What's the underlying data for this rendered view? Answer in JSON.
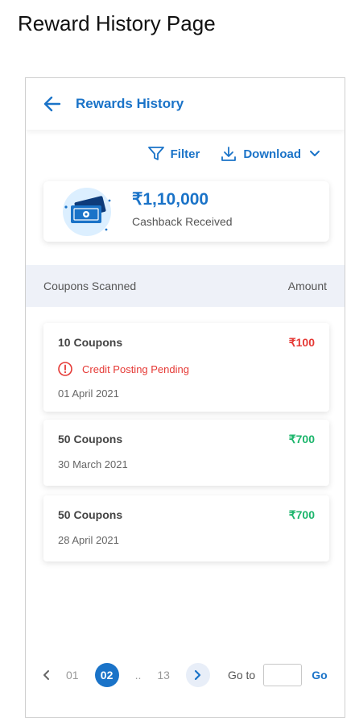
{
  "caption": "Reward History Page",
  "header": {
    "title": "Rewards History"
  },
  "toolbar": {
    "filter_label": "Filter",
    "download_label": "Download"
  },
  "summary": {
    "amount": "₹1,10,000",
    "label": "Cashback Received"
  },
  "table": {
    "col_left": "Coupons Scanned",
    "col_right": "Amount"
  },
  "entries": [
    {
      "title": "10 Coupons",
      "amount": "₹100",
      "status": "Credit Posting Pending",
      "date": "01 April 2021",
      "amount_color": "#e53935"
    },
    {
      "title": "50 Coupons",
      "amount": "₹700",
      "date": "30 March 2021",
      "amount_color": "#1bb56b"
    },
    {
      "title": "50 Coupons",
      "amount": "₹700",
      "date": "28 April 2021",
      "amount_color": "#1bb56b"
    }
  ],
  "pagination": {
    "prev_page": "01",
    "current_page": "02",
    "ellipsis": "..",
    "last_page": "13",
    "goto_label": "Go to",
    "goto_value": "",
    "go_label": "Go"
  },
  "colors": {
    "accent": "#1a73c8",
    "danger": "#e53935",
    "success": "#1bb56b",
    "table_header_bg": "#eef1f8"
  },
  "icons": [
    "back-arrow-icon",
    "filter-icon",
    "download-icon",
    "chevron-down-icon",
    "cash-icon",
    "alert-circle-icon",
    "chevron-left-icon",
    "chevron-right-icon"
  ]
}
